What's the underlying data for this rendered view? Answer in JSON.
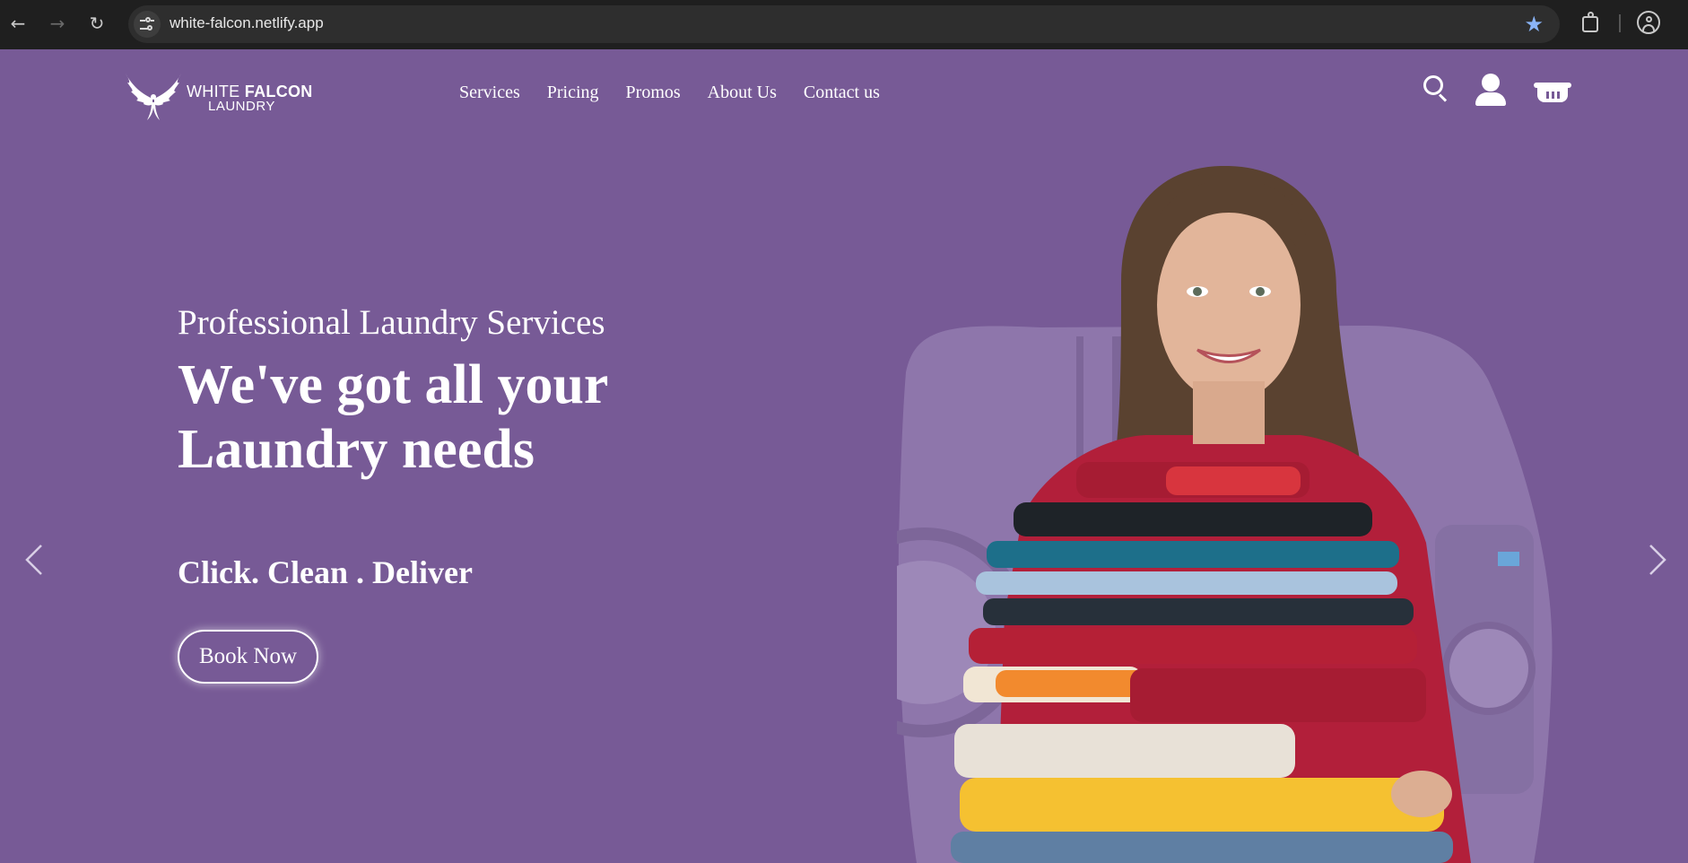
{
  "browser": {
    "url": "white-falcon.netlify.app",
    "icons": {
      "back": "arrow-left-icon",
      "forward": "arrow-right-icon",
      "reload": "reload-icon",
      "site_info": "tune-icon",
      "bookmark": "star-icon",
      "extensions": "puzzle-icon",
      "profile": "account-circle-icon"
    }
  },
  "header": {
    "logo": {
      "line1_light": "WHITE ",
      "line1_bold": "FALCON",
      "line2": "LAUNDRY"
    },
    "nav": [
      "Services",
      "Pricing",
      "Promos",
      "About Us",
      "Contact us"
    ],
    "icons": [
      "search-icon",
      "user-icon",
      "basket-icon"
    ]
  },
  "hero": {
    "subtitle": "Professional Laundry Services",
    "headline": "We've got all your Laundry needs",
    "tagline": "Click. Clean . Deliver",
    "cta_label": "Book Now"
  },
  "colors": {
    "background": "#775a96",
    "chrome": "#1f1f1f",
    "text": "#ffffff",
    "bookmark_star": "#8ab4f8"
  }
}
